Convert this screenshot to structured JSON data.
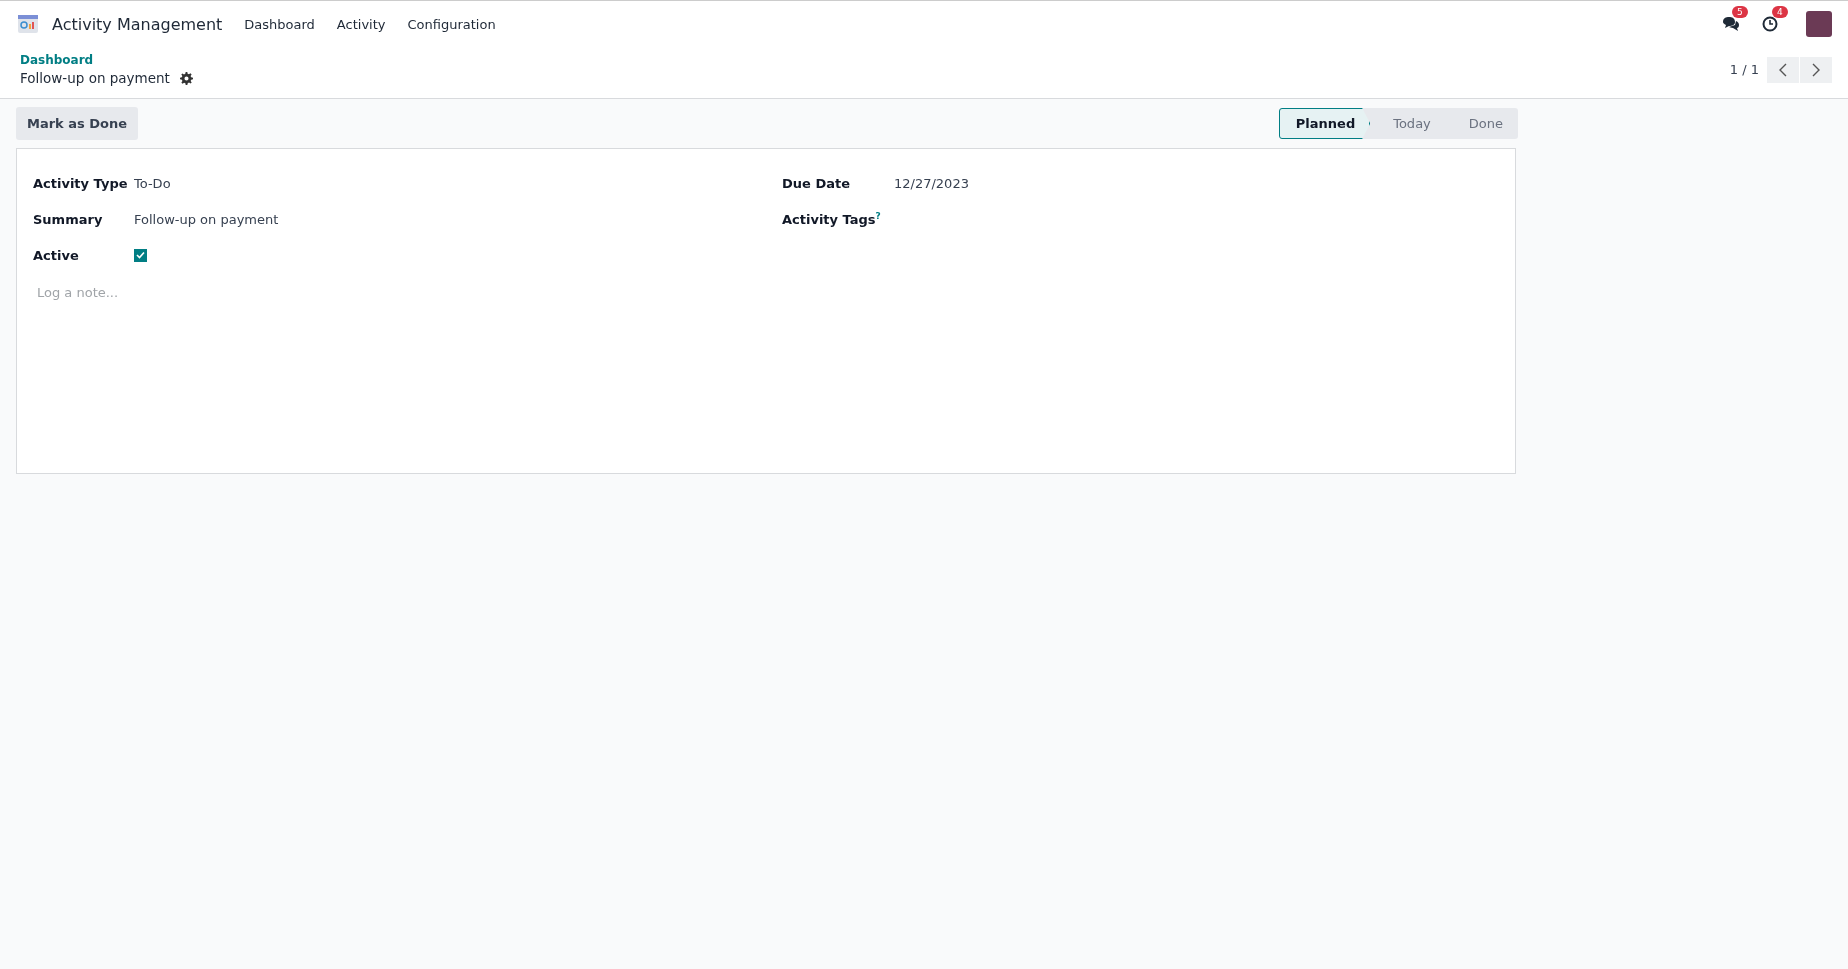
{
  "navbar": {
    "app_name": "Activity Management",
    "menu": [
      "Dashboard",
      "Activity",
      "Configuration"
    ],
    "messages_badge": "5",
    "activities_badge": "4"
  },
  "breadcrumb": {
    "parent": "Dashboard",
    "current": "Follow-up on payment"
  },
  "pager": {
    "value": "1 / 1"
  },
  "actions": {
    "button": "Mark as Done"
  },
  "stages": [
    {
      "label": "Planned",
      "selected": true
    },
    {
      "label": "Today",
      "selected": false
    },
    {
      "label": "Done",
      "selected": false
    }
  ],
  "form": {
    "left": [
      {
        "label": "Activity Type",
        "kind": "text",
        "value": "To-Do"
      },
      {
        "label": "Summary",
        "kind": "text",
        "value": "Follow-up on payment"
      },
      {
        "label": "Active",
        "kind": "checkbox",
        "checked": true
      }
    ],
    "right": [
      {
        "label": "Due Date",
        "kind": "text",
        "value": "12/27/2023"
      },
      {
        "label": "Activity Tags$^{?}$",
        "kind": "tags"
      }
    ],
    "note": {
      "placeholder": "Log a note..."
    }
  }
}
